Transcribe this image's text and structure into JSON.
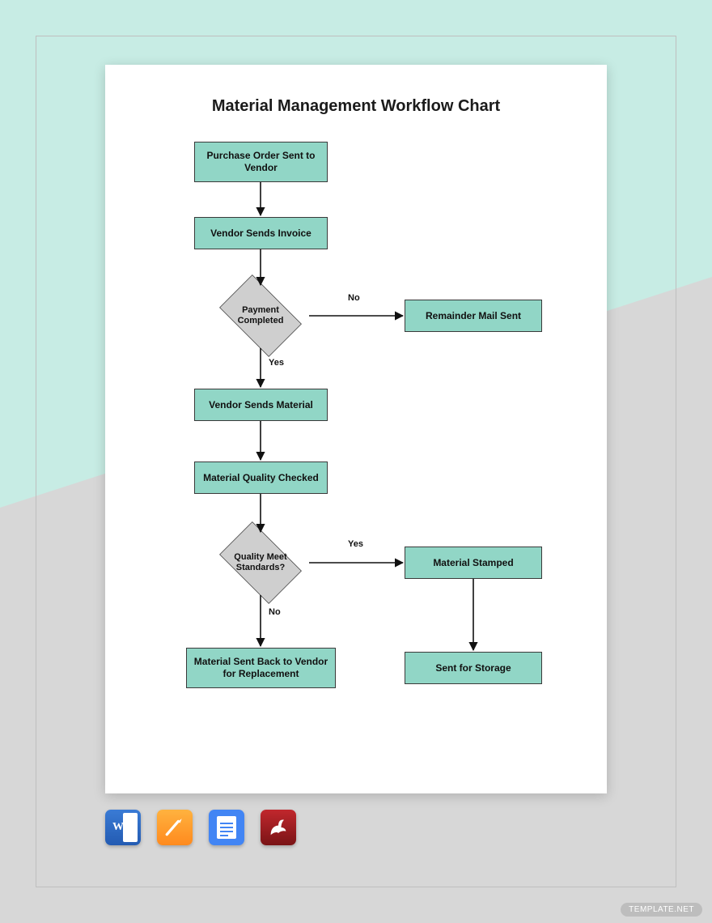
{
  "title": "Material Management Workflow Chart",
  "nodes": {
    "n1": "Purchase Order Sent to Vendor",
    "n2": "Vendor Sends Invoice",
    "d1": "Payment Completed",
    "n3": "Remainder Mail Sent",
    "n4": "Vendor Sends Material",
    "n5": "Material Quality Checked",
    "d2": "Quality Meet Standards?",
    "n6": "Material Stamped",
    "n7": "Material Sent Back to Vendor for Replacement",
    "n8": "Sent for Storage"
  },
  "labels": {
    "no": "No",
    "yes": "Yes"
  },
  "apps": {
    "word": "W",
    "pages": "pages",
    "gdocs": "gdocs",
    "pdf": "pdf"
  },
  "watermark": "TEMPLATE.NET"
}
